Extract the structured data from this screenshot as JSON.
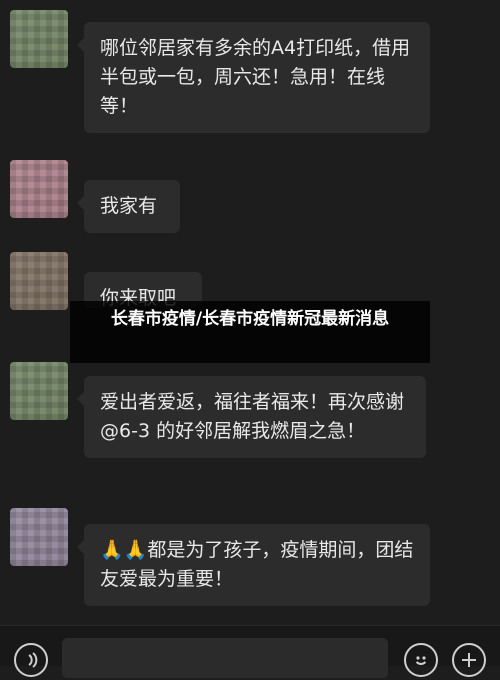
{
  "messages": [
    {
      "text": "哪位邻居家有多余的A4打印纸，借用半包或一包，周六还！急用！在线等！"
    },
    {
      "text": "我家有"
    },
    {
      "text": "你来取吧"
    },
    {
      "text": "爱出者爱返，福往者福来！再次感谢 @6-3 的好邻居解我燃眉之急！"
    },
    {
      "text": "🙏🙏都是为了孩子，疫情期间，团结友爱最为重要！"
    }
  ],
  "overlay": {
    "title": "长春市疫情/长春市疫情新冠最新消息"
  },
  "bottom_bar": {
    "left_icon": "voice-icon",
    "emoji_icon": "emoji-icon",
    "add_icon": "add-icon"
  }
}
